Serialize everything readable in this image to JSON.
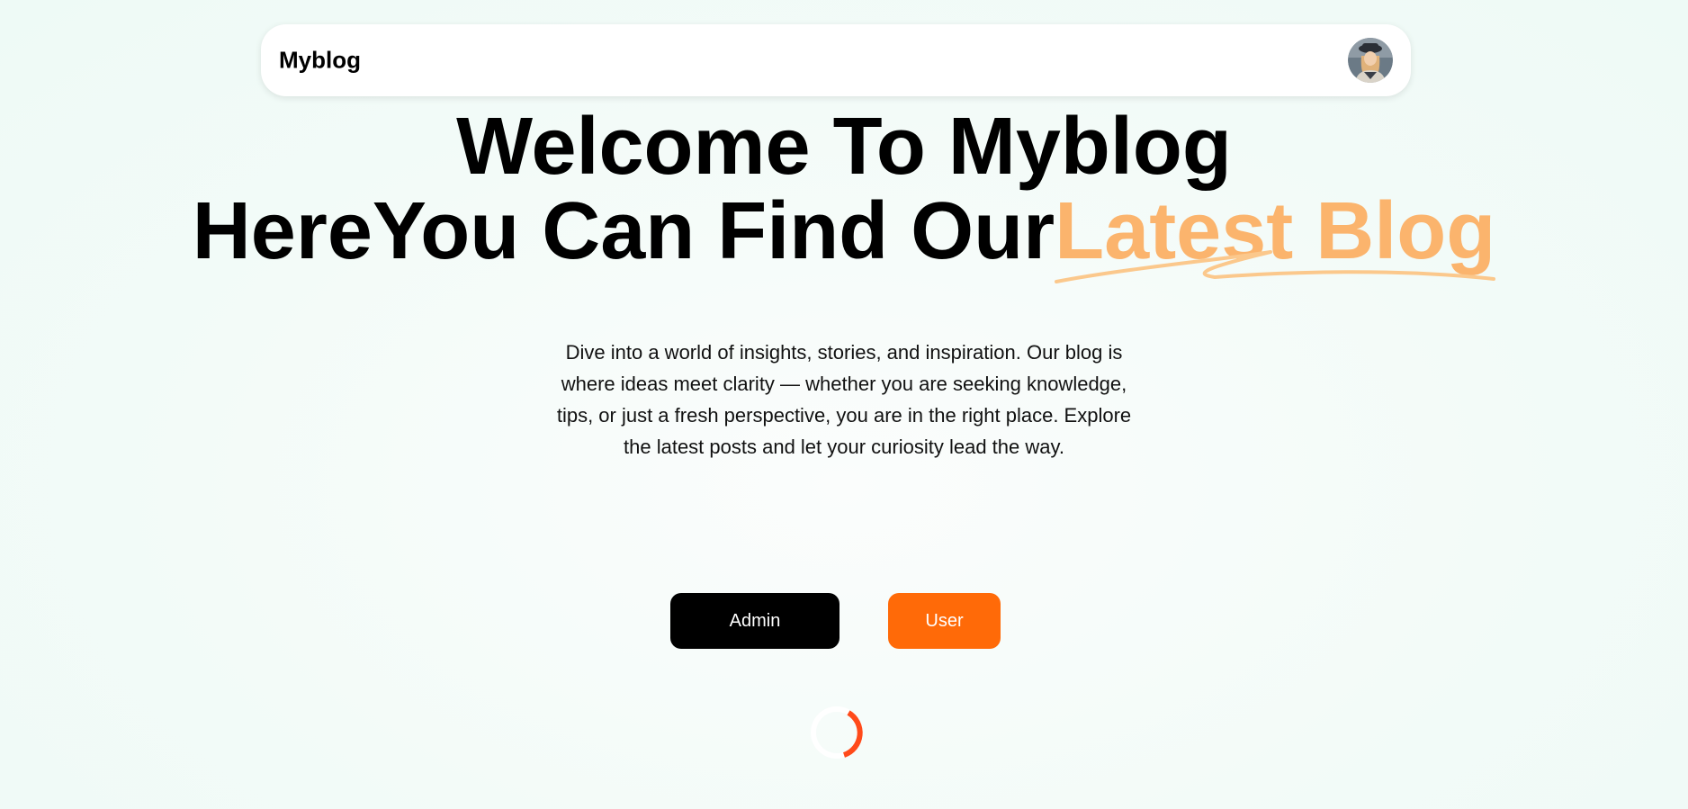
{
  "navbar": {
    "brand": "Myblog",
    "avatar_icon": "user-avatar-icon"
  },
  "hero": {
    "line1": "Welcome To Myblog",
    "line2_prefix": "HereYou Can Find Our",
    "line2_highlight": "Latest Blog",
    "highlight_color": "#fbb46d"
  },
  "description": "Dive into a world of insights, stories, and inspiration. Our blog is where ideas meet clarity — whether you are seeking knowledge, tips, or just a fresh perspective, you are in the right place. Explore the latest posts and let your curiosity lead the way.",
  "buttons": {
    "admin_label": "Admin",
    "admin_color": "#000000",
    "user_label": "User",
    "user_color": "#ff6a08"
  },
  "loader": {
    "icon": "loading-spinner-icon",
    "accent_color": "#ff4a1a"
  }
}
